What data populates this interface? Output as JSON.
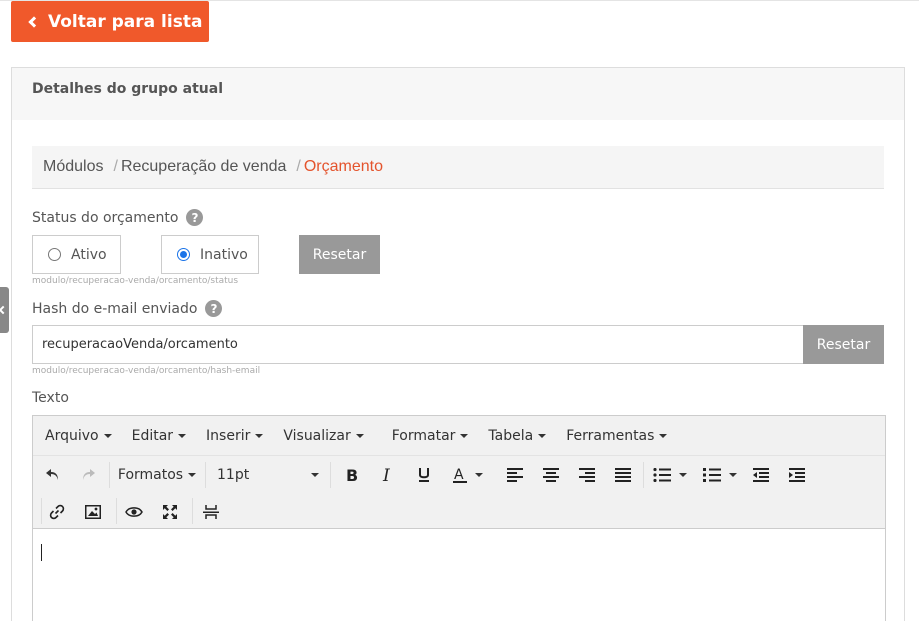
{
  "back_button": {
    "label": "Voltar para lista"
  },
  "panel": {
    "title": "Detalhes do grupo atual"
  },
  "breadcrumb": {
    "items": [
      {
        "label": "Módulos"
      },
      {
        "label": "Recuperação de venda"
      },
      {
        "label": "Orçamento"
      }
    ],
    "separator": "/"
  },
  "status": {
    "label": "Status do orçamento",
    "help": "?",
    "options": [
      {
        "label": "Ativo",
        "checked": false
      },
      {
        "label": "Inativo",
        "checked": true
      }
    ],
    "reset_label": "Resetar",
    "hint": "modulo/recuperacao-venda/orcamento/status"
  },
  "hash": {
    "label": "Hash do e-mail enviado",
    "help": "?",
    "value": "recuperacaoVenda/orcamento",
    "reset_label": "Resetar",
    "hint": "modulo/recuperacao-venda/orcamento/hash-email"
  },
  "texto": {
    "label": "Texto",
    "menu": [
      "Arquivo",
      "Editar",
      "Inserir",
      "Visualizar",
      "Formatar",
      "Tabela",
      "Ferramentas"
    ],
    "formats_label": "Formatos",
    "font_size": "11pt"
  },
  "colors": {
    "accent": "#f0592b",
    "breadcrumb_active": "#e4542d",
    "radio_checked": "#1a73e8",
    "button_gray": "#999999"
  }
}
